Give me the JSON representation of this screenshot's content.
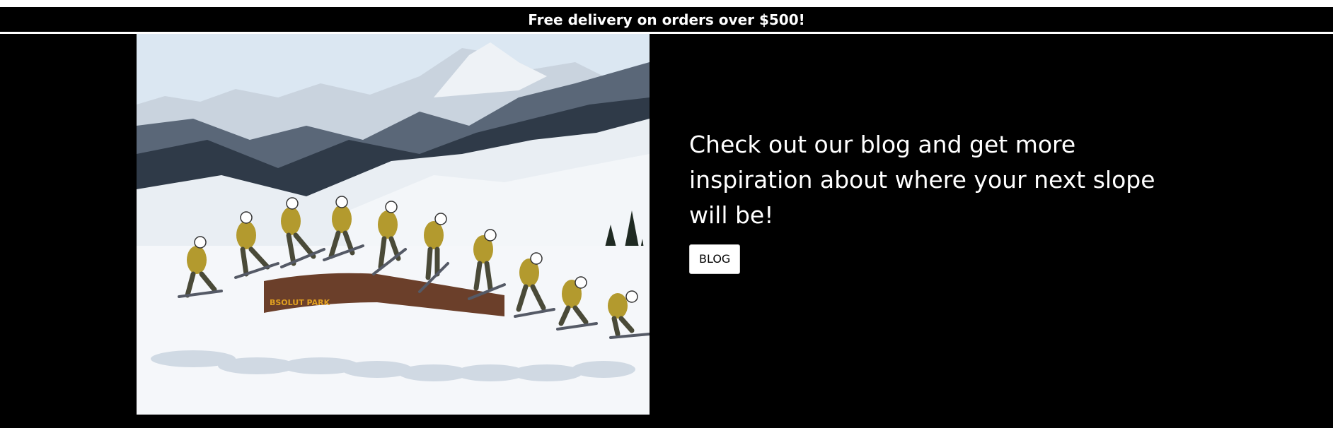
{
  "promo": {
    "text": "Free delivery on orders over $500!"
  },
  "hero": {
    "image_label": "BSOLUT PARK",
    "headline": "Check out our blog and get more inspiration about where your next slope will be!",
    "button_label": "BLOG"
  },
  "colors": {
    "background": "#000000",
    "text": "#ffffff",
    "button_bg": "#ffffff",
    "button_text": "#000000",
    "jacket": "#b39a2e",
    "park_box": "#6b3f2a"
  }
}
